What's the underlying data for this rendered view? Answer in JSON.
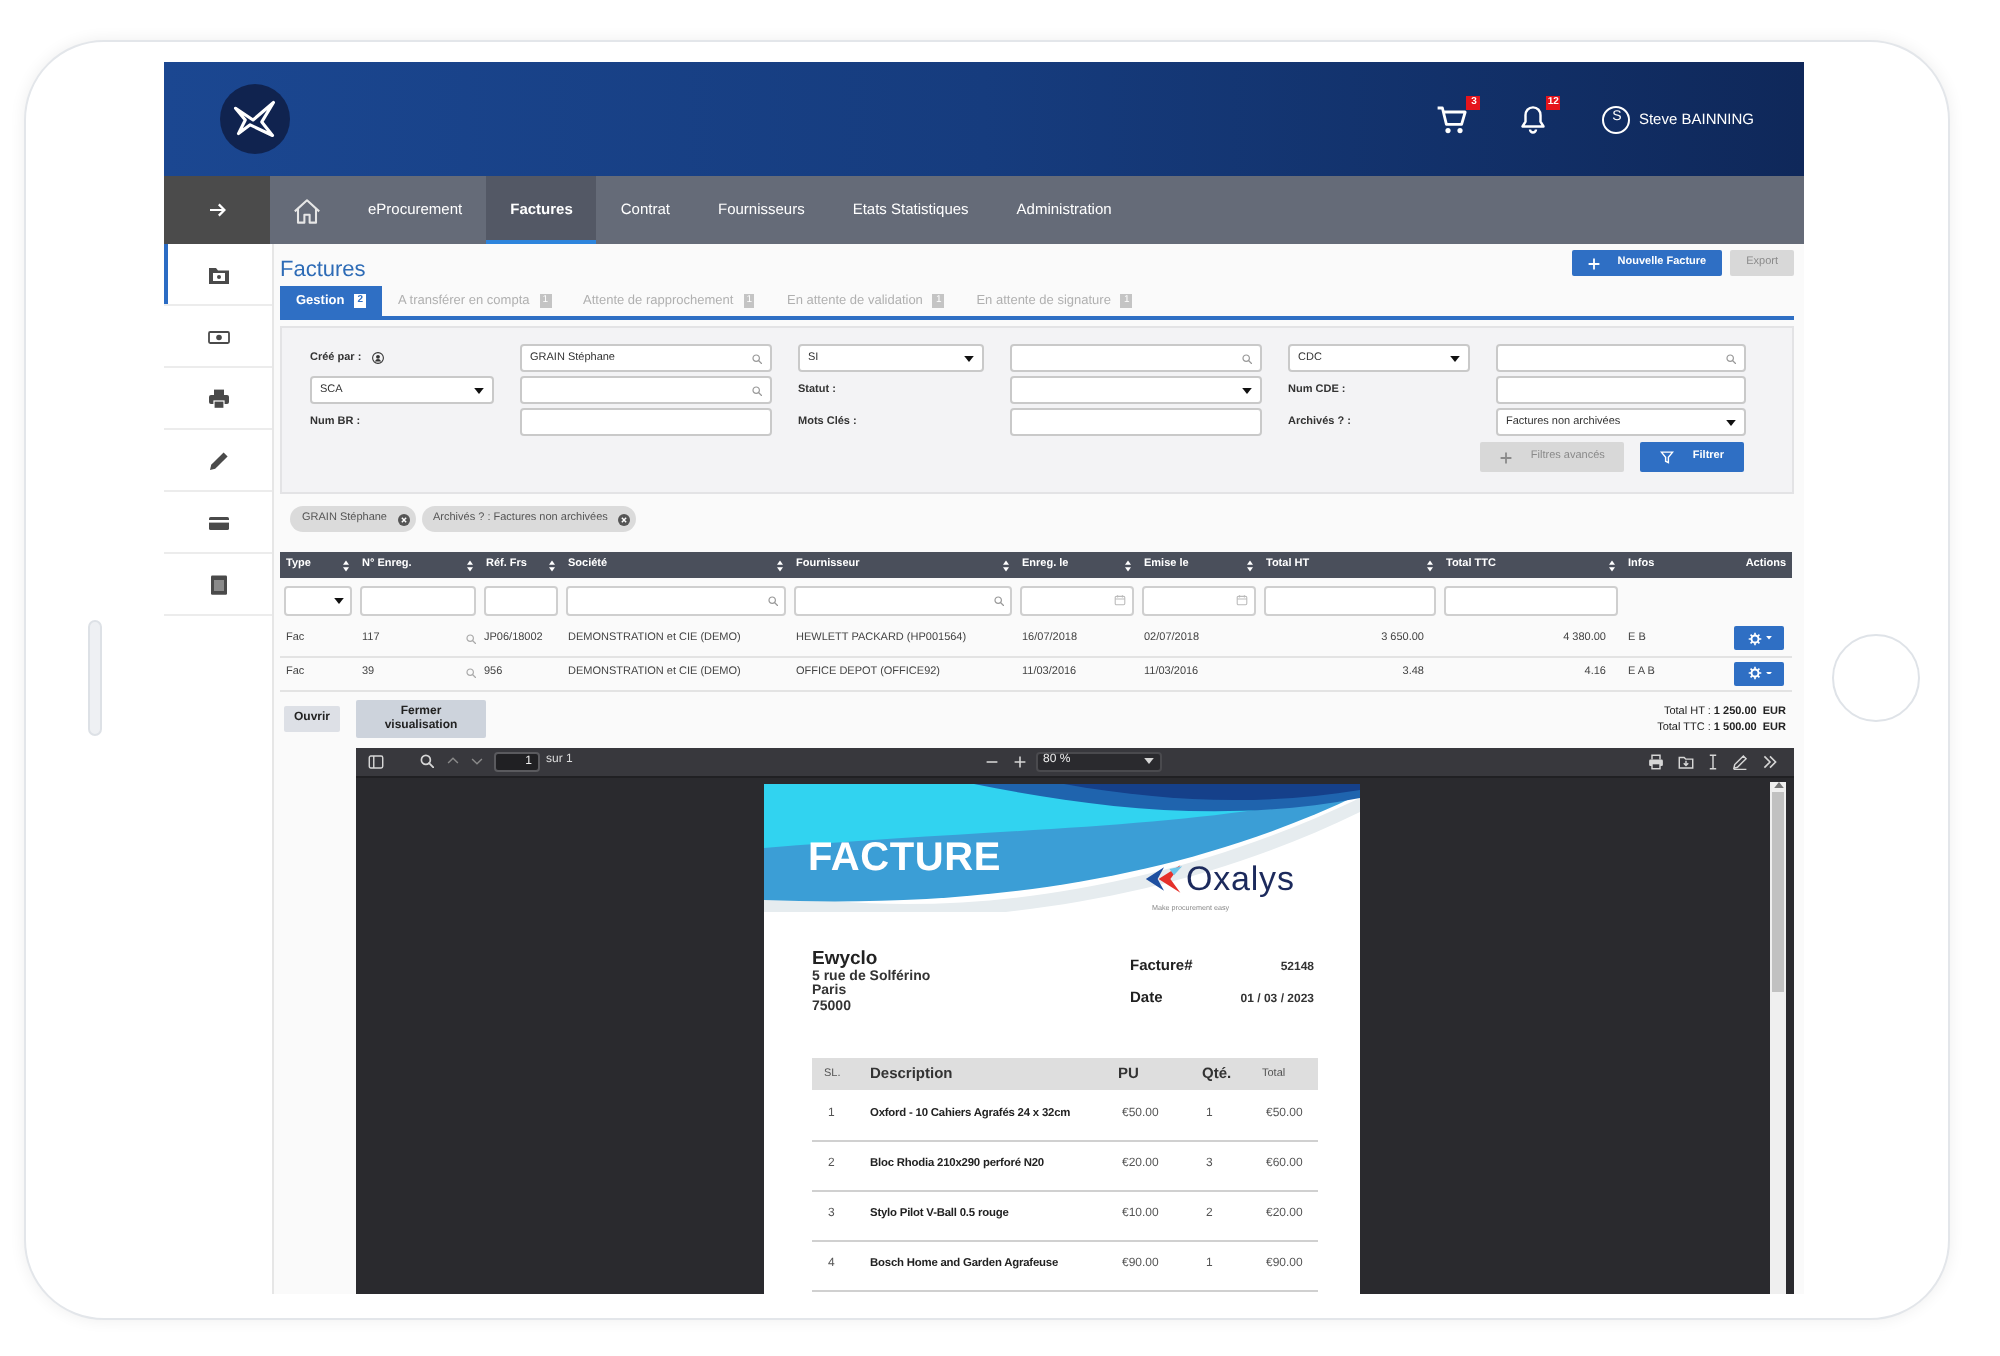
{
  "header": {
    "cart_count": "3",
    "notification_count": "12",
    "user_initial": "S",
    "user_name": "Steve BAINNING"
  },
  "nav": {
    "items": [
      {
        "label": "eProcurement",
        "selected": false
      },
      {
        "label": "Factures",
        "selected": true
      },
      {
        "label": "Contrat",
        "selected": false
      },
      {
        "label": "Fournisseurs",
        "selected": false
      },
      {
        "label": "Etats Statistiques",
        "selected": false
      },
      {
        "label": "Administration",
        "selected": false
      }
    ]
  },
  "sidebar": {
    "items": [
      {
        "selected": true
      },
      {
        "selected": false
      },
      {
        "selected": false
      },
      {
        "selected": false
      },
      {
        "selected": false
      },
      {
        "selected": false
      }
    ]
  },
  "page": {
    "title": "Factures",
    "buttons": [
      {
        "label": "Nouvelle Facture",
        "kind": "primary"
      },
      {
        "label": "Export",
        "kind": "muted"
      }
    ]
  },
  "tabs": [
    {
      "label": "Gestion",
      "count": "2",
      "selected": true
    },
    {
      "label": "A transférer en compta",
      "count": "1",
      "selected": false
    },
    {
      "label": "Attente de rapprochement",
      "count": "1",
      "selected": false
    },
    {
      "label": "En attente de validation",
      "count": "1",
      "selected": false
    },
    {
      "label": "En attente de signature",
      "count": "1",
      "selected": false
    }
  ],
  "filters": {
    "rows": [
      [
        {
          "kind": "user_label",
          "label": "Créé par :"
        },
        {
          "kind": "search",
          "value": "GRAIN Stéphane"
        },
        {
          "kind": "select",
          "value": "SI"
        },
        {
          "kind": "search"
        },
        {
          "kind": "select",
          "value": "CDC"
        },
        {
          "kind": "search"
        }
      ],
      [
        {
          "kind": "select",
          "value": "SCA"
        },
        {
          "kind": "search"
        },
        {
          "kind": "label",
          "label": "Statut :"
        },
        {
          "kind": "select"
        },
        {
          "kind": "label",
          "label": "Num CDE :"
        },
        {
          "kind": "input"
        }
      ],
      [
        {
          "kind": "label",
          "label": "Num BR :"
        },
        {
          "kind": "input"
        },
        {
          "kind": "label",
          "label": "Mots Clés :"
        },
        {
          "kind": "input"
        },
        {
          "kind": "label",
          "label": "Archivés ? :"
        },
        {
          "kind": "select",
          "value": "Factures non archivées"
        }
      ]
    ],
    "buttons": [
      {
        "label": "Filtres avancés",
        "kind": "muted"
      },
      {
        "label": "Filtrer",
        "kind": "primary"
      }
    ]
  },
  "chips": [
    {
      "label": "GRAIN Stéphane"
    },
    {
      "label": "Archivés ? : Factures non archivées"
    }
  ],
  "table": {
    "columns": [
      {
        "label": "Type",
        "kind": "text",
        "sortable": true,
        "filter": {
          "kind": "select"
        }
      },
      {
        "label": "N° Enreg.",
        "kind": "text",
        "sortable": true,
        "filter": {
          "kind": "input"
        }
      },
      {
        "label": "Réf. Frs",
        "kind": "lookup",
        "sortable": true,
        "filter": {
          "kind": "input"
        }
      },
      {
        "label": "Société",
        "kind": "text",
        "sortable": true,
        "filter": {
          "kind": "search"
        }
      },
      {
        "label": "Fournisseur",
        "kind": "text",
        "sortable": true,
        "filter": {
          "kind": "search"
        }
      },
      {
        "label": "Enreg. le",
        "kind": "text",
        "sortable": true,
        "filter": {
          "kind": "date"
        }
      },
      {
        "label": "Emise le",
        "kind": "text",
        "sortable": true,
        "filter": {
          "kind": "date"
        }
      },
      {
        "label": "Total HT",
        "kind": "amount",
        "sortable": true,
        "filter": {
          "kind": "input"
        }
      },
      {
        "label": "Total TTC",
        "kind": "amount",
        "sortable": true,
        "filter": {
          "kind": "input"
        }
      },
      {
        "label": "Infos",
        "kind": "text",
        "sortable": false
      },
      {
        "label": "Actions",
        "kind": "action",
        "sortable": false
      }
    ],
    "rows": [
      {
        "cells": [
          "Fac",
          "117",
          "JP06/18002",
          "DEMONSTRATION et CIE (DEMO)",
          "HEWLETT PACKARD (HP001564)",
          "16/07/2018",
          "02/07/2018",
          "3 650.00",
          "4 380.00",
          "E B"
        ]
      },
      {
        "cells": [
          "Fac",
          "39",
          "956",
          "DEMONSTRATION et CIE (DEMO)",
          "OFFICE DEPOT (OFFICE92)",
          "11/03/2016",
          "11/03/2016",
          "3.48",
          "4.16",
          "E A B"
        ]
      }
    ]
  },
  "actions": {
    "buttons": [
      {
        "label": "Ouvrir"
      },
      {
        "label": "Fermer visualisation"
      }
    ],
    "totals": [
      {
        "label": "Total HT :",
        "value": "1 250.00  EUR"
      },
      {
        "label": "Total TTC :",
        "value": "1 500.00  EUR"
      }
    ]
  },
  "pdf_viewer": {
    "page_number": "1",
    "page_count": "sur 1",
    "zoom": "80 %",
    "document": {
      "title": "FACTURE",
      "brand": "Oxalys",
      "tagline": "Make procurement easy",
      "sender": {
        "name": "Ewyclo",
        "address": [
          "5 rue de Solférino",
          "Paris",
          "75000"
        ]
      },
      "meta": [
        {
          "label": "Facture#",
          "value": "52148"
        },
        {
          "label": "Date",
          "value": "01 / 03 / 2023"
        }
      ],
      "items": {
        "columns": [
          "SL.",
          "Description",
          "PU",
          "Qté.",
          "Total"
        ],
        "rows": [
          [
            "1",
            "Oxford - 10 Cahiers Agrafés 24 x 32cm",
            "€50.00",
            "1",
            "€50.00"
          ],
          [
            "2",
            "Bloc Rhodia 210x290 perforé N20",
            "€20.00",
            "3",
            "€60.00"
          ],
          [
            "3",
            "Stylo Pilot V-Ball 0.5 rouge",
            "€10.00",
            "2",
            "€20.00"
          ],
          [
            "4",
            "Bosch Home and Garden Agrafeuse",
            "€90.00",
            "1",
            "€90.00"
          ]
        ]
      }
    }
  }
}
